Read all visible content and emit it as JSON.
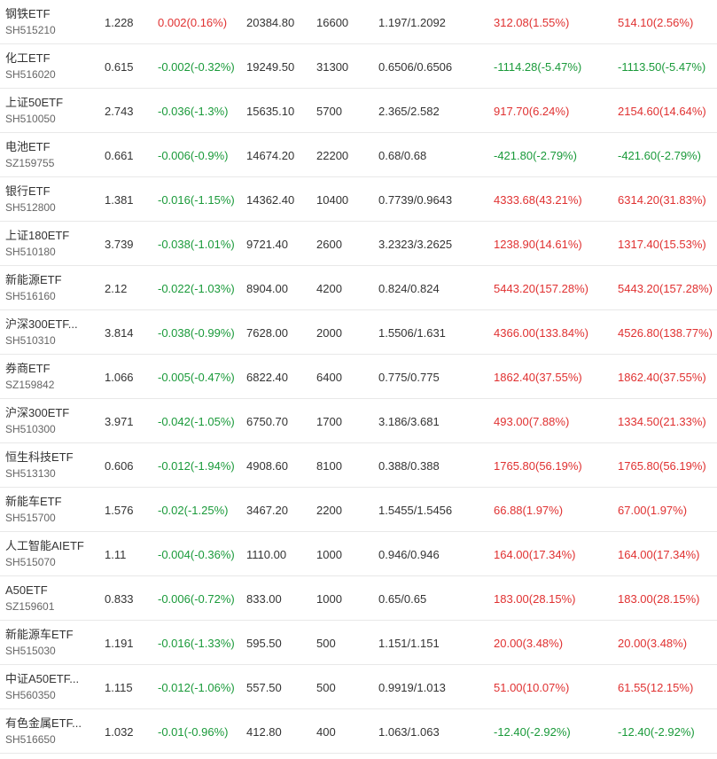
{
  "colors": {
    "up": "#e03131",
    "down": "#1a9a3a",
    "text": "#333333",
    "code": "#666666"
  },
  "rows": [
    {
      "name": "钢铁ETF",
      "code": "SH515210",
      "price": "1.228",
      "change": "0.002(0.16%)",
      "value": "20384.80",
      "qty": "16600",
      "cost": "1.197/1.2092",
      "pnl": "312.08(1.55%)",
      "pnl_total": "514.10(2.56%)",
      "chg_dir": "up",
      "pnl_dir": "up",
      "pnl_total_dir": "up"
    },
    {
      "name": "化工ETF",
      "code": "SH516020",
      "price": "0.615",
      "change": "-0.002(-0.32%)",
      "value": "19249.50",
      "qty": "31300",
      "cost": "0.6506/0.6506",
      "pnl": "-1114.28(-5.47%)",
      "pnl_total": "-1113.50(-5.47%)",
      "chg_dir": "down",
      "pnl_dir": "down",
      "pnl_total_dir": "down"
    },
    {
      "name": "上证50ETF",
      "code": "SH510050",
      "price": "2.743",
      "change": "-0.036(-1.3%)",
      "value": "15635.10",
      "qty": "5700",
      "cost": "2.365/2.582",
      "pnl": "917.70(6.24%)",
      "pnl_total": "2154.60(14.64%)",
      "chg_dir": "down",
      "pnl_dir": "up",
      "pnl_total_dir": "up"
    },
    {
      "name": "电池ETF",
      "code": "SZ159755",
      "price": "0.661",
      "change": "-0.006(-0.9%)",
      "value": "14674.20",
      "qty": "22200",
      "cost": "0.68/0.68",
      "pnl": "-421.80(-2.79%)",
      "pnl_total": "-421.60(-2.79%)",
      "chg_dir": "down",
      "pnl_dir": "down",
      "pnl_total_dir": "down"
    },
    {
      "name": "银行ETF",
      "code": "SH512800",
      "price": "1.381",
      "change": "-0.016(-1.15%)",
      "value": "14362.40",
      "qty": "10400",
      "cost": "0.7739/0.9643",
      "pnl": "4333.68(43.21%)",
      "pnl_total": "6314.20(31.83%)",
      "chg_dir": "down",
      "pnl_dir": "up",
      "pnl_total_dir": "up"
    },
    {
      "name": "上证180ETF",
      "code": "SH510180",
      "price": "3.739",
      "change": "-0.038(-1.01%)",
      "value": "9721.40",
      "qty": "2600",
      "cost": "3.2323/3.2625",
      "pnl": "1238.90(14.61%)",
      "pnl_total": "1317.40(15.53%)",
      "chg_dir": "down",
      "pnl_dir": "up",
      "pnl_total_dir": "up"
    },
    {
      "name": "新能源ETF",
      "code": "SH516160",
      "price": "2.12",
      "change": "-0.022(-1.03%)",
      "value": "8904.00",
      "qty": "4200",
      "cost": "0.824/0.824",
      "pnl": "5443.20(157.28%)",
      "pnl_total": "5443.20(157.28%)",
      "chg_dir": "down",
      "pnl_dir": "up",
      "pnl_total_dir": "up"
    },
    {
      "name": "沪深300ETF...",
      "code": "SH510310",
      "price": "3.814",
      "change": "-0.038(-0.99%)",
      "value": "7628.00",
      "qty": "2000",
      "cost": "1.5506/1.631",
      "pnl": "4366.00(133.84%)",
      "pnl_total": "4526.80(138.77%)",
      "chg_dir": "down",
      "pnl_dir": "up",
      "pnl_total_dir": "up"
    },
    {
      "name": "券商ETF",
      "code": "SZ159842",
      "price": "1.066",
      "change": "-0.005(-0.47%)",
      "value": "6822.40",
      "qty": "6400",
      "cost": "0.775/0.775",
      "pnl": "1862.40(37.55%)",
      "pnl_total": "1862.40(37.55%)",
      "chg_dir": "down",
      "pnl_dir": "up",
      "pnl_total_dir": "up"
    },
    {
      "name": "沪深300ETF",
      "code": "SH510300",
      "price": "3.971",
      "change": "-0.042(-1.05%)",
      "value": "6750.70",
      "qty": "1700",
      "cost": "3.186/3.681",
      "pnl": "493.00(7.88%)",
      "pnl_total": "1334.50(21.33%)",
      "chg_dir": "down",
      "pnl_dir": "up",
      "pnl_total_dir": "up"
    },
    {
      "name": "恒生科技ETF",
      "code": "SH513130",
      "price": "0.606",
      "change": "-0.012(-1.94%)",
      "value": "4908.60",
      "qty": "8100",
      "cost": "0.388/0.388",
      "pnl": "1765.80(56.19%)",
      "pnl_total": "1765.80(56.19%)",
      "chg_dir": "down",
      "pnl_dir": "up",
      "pnl_total_dir": "up"
    },
    {
      "name": "新能车ETF",
      "code": "SH515700",
      "price": "1.576",
      "change": "-0.02(-1.25%)",
      "value": "3467.20",
      "qty": "2200",
      "cost": "1.5455/1.5456",
      "pnl": "66.88(1.97%)",
      "pnl_total": "67.00(1.97%)",
      "chg_dir": "down",
      "pnl_dir": "up",
      "pnl_total_dir": "up"
    },
    {
      "name": "人工智能AIETF",
      "code": "SH515070",
      "price": "1.11",
      "change": "-0.004(-0.36%)",
      "value": "1110.00",
      "qty": "1000",
      "cost": "0.946/0.946",
      "pnl": "164.00(17.34%)",
      "pnl_total": "164.00(17.34%)",
      "chg_dir": "down",
      "pnl_dir": "up",
      "pnl_total_dir": "up"
    },
    {
      "name": "A50ETF",
      "code": "SZ159601",
      "price": "0.833",
      "change": "-0.006(-0.72%)",
      "value": "833.00",
      "qty": "1000",
      "cost": "0.65/0.65",
      "pnl": "183.00(28.15%)",
      "pnl_total": "183.00(28.15%)",
      "chg_dir": "down",
      "pnl_dir": "up",
      "pnl_total_dir": "up"
    },
    {
      "name": "新能源车ETF",
      "code": "SH515030",
      "price": "1.191",
      "change": "-0.016(-1.33%)",
      "value": "595.50",
      "qty": "500",
      "cost": "1.151/1.151",
      "pnl": "20.00(3.48%)",
      "pnl_total": "20.00(3.48%)",
      "chg_dir": "down",
      "pnl_dir": "up",
      "pnl_total_dir": "up"
    },
    {
      "name": "中证A50ETF...",
      "code": "SH560350",
      "price": "1.115",
      "change": "-0.012(-1.06%)",
      "value": "557.50",
      "qty": "500",
      "cost": "0.9919/1.013",
      "pnl": "51.00(10.07%)",
      "pnl_total": "61.55(12.15%)",
      "chg_dir": "down",
      "pnl_dir": "up",
      "pnl_total_dir": "up"
    },
    {
      "name": "有色金属ETF...",
      "code": "SH516650",
      "price": "1.032",
      "change": "-0.01(-0.96%)",
      "value": "412.80",
      "qty": "400",
      "cost": "1.063/1.063",
      "pnl": "-12.40(-2.92%)",
      "pnl_total": "-12.40(-2.92%)",
      "chg_dir": "down",
      "pnl_dir": "down",
      "pnl_total_dir": "down"
    }
  ]
}
